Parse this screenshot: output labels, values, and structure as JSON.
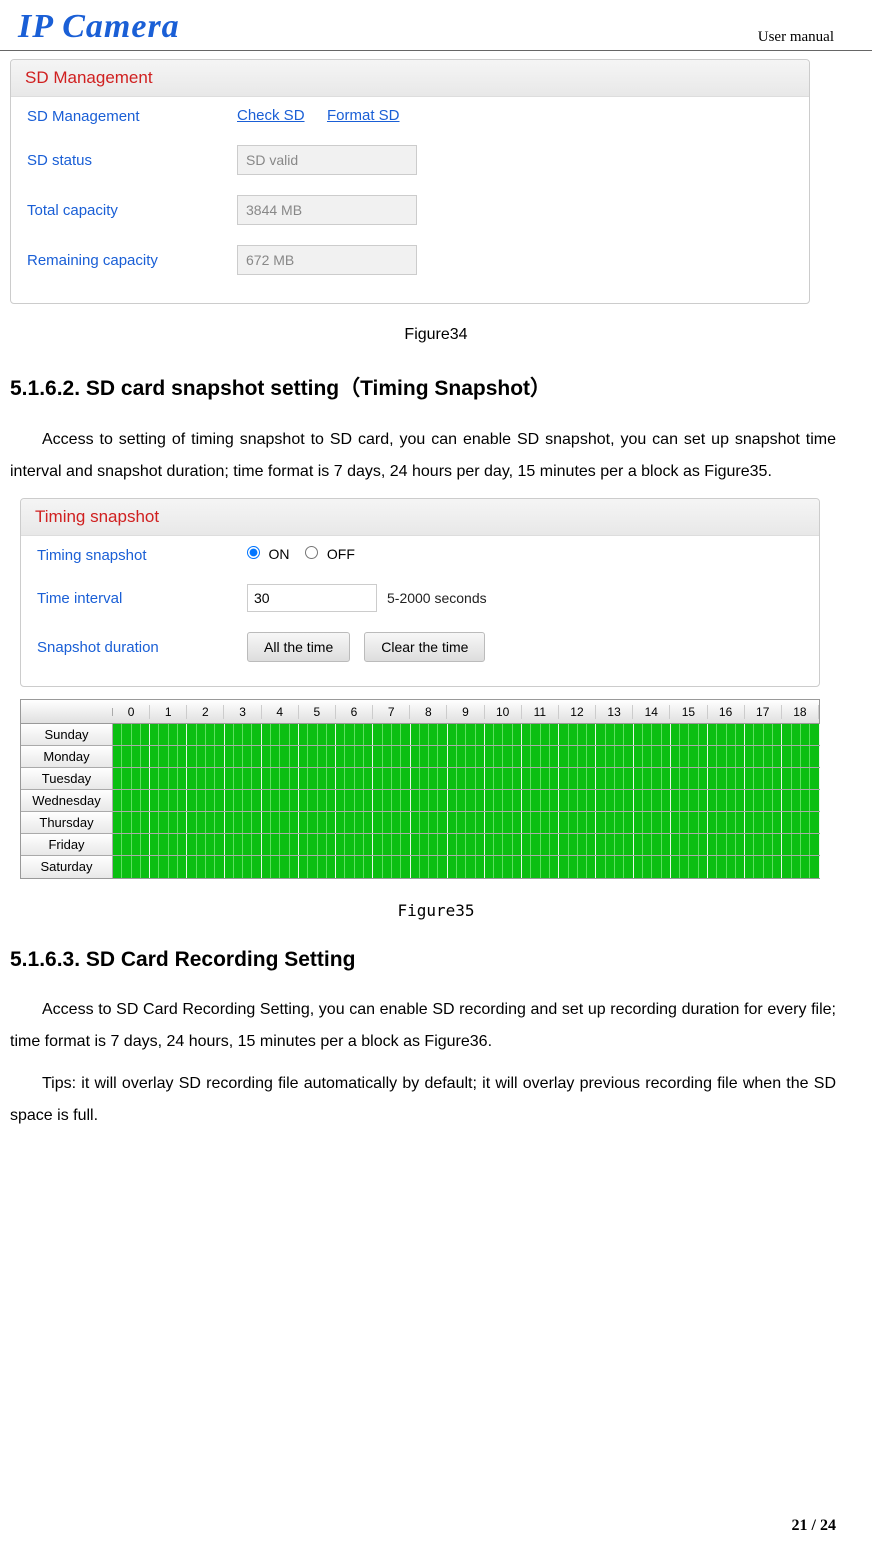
{
  "header": {
    "logo": "IP Camera",
    "right": "User manual"
  },
  "page_number": "21 / 24",
  "panel1": {
    "title": "SD Management",
    "rows": {
      "mgmt_label": "SD Management",
      "check_link": "Check SD",
      "format_link": "Format SD",
      "status_label": "SD status",
      "status_value": "SD valid",
      "total_label": "Total capacity",
      "total_value": "3844 MB",
      "remain_label": "Remaining capacity",
      "remain_value": "672 MB"
    }
  },
  "fig34": "Figure34",
  "sec5162": {
    "heading": "5.1.6.2. SD card snapshot setting（Timing Snapshot）",
    "para": "Access to setting of timing snapshot to SD card, you can enable SD snapshot, you can set up snapshot time interval and snapshot duration; time format is 7 days, 24 hours per day, 15 minutes per a block as Figure35."
  },
  "panel2": {
    "title": "Timing snapshot",
    "ts_label": "Timing snapshot",
    "on_label": "ON",
    "off_label": "OFF",
    "ts_selected": "on",
    "ti_label": "Time interval",
    "ti_value": "30",
    "ti_hint": "5-2000 seconds",
    "dur_label": "Snapshot duration",
    "btn_all": "All the time",
    "btn_clear": "Clear the time"
  },
  "schedule": {
    "hours": [
      "0",
      "1",
      "2",
      "3",
      "4",
      "5",
      "6",
      "7",
      "8",
      "9",
      "10",
      "11",
      "12",
      "13",
      "14",
      "15",
      "16",
      "17",
      "18"
    ],
    "days": [
      "Sunday",
      "Monday",
      "Tuesday",
      "Wednesday",
      "Thursday",
      "Friday",
      "Saturday"
    ]
  },
  "fig35": "Figure35",
  "sec5163": {
    "heading": "5.1.6.3. SD Card Recording Setting",
    "para1": "Access to SD Card Recording Setting, you can enable SD recording and set up recording duration for every file; time format is 7 days, 24 hours, 15 minutes per a block as Figure36.",
    "para2": "Tips: it will overlay SD recording file automatically by default; it will overlay previous recording file when the SD space is full."
  }
}
